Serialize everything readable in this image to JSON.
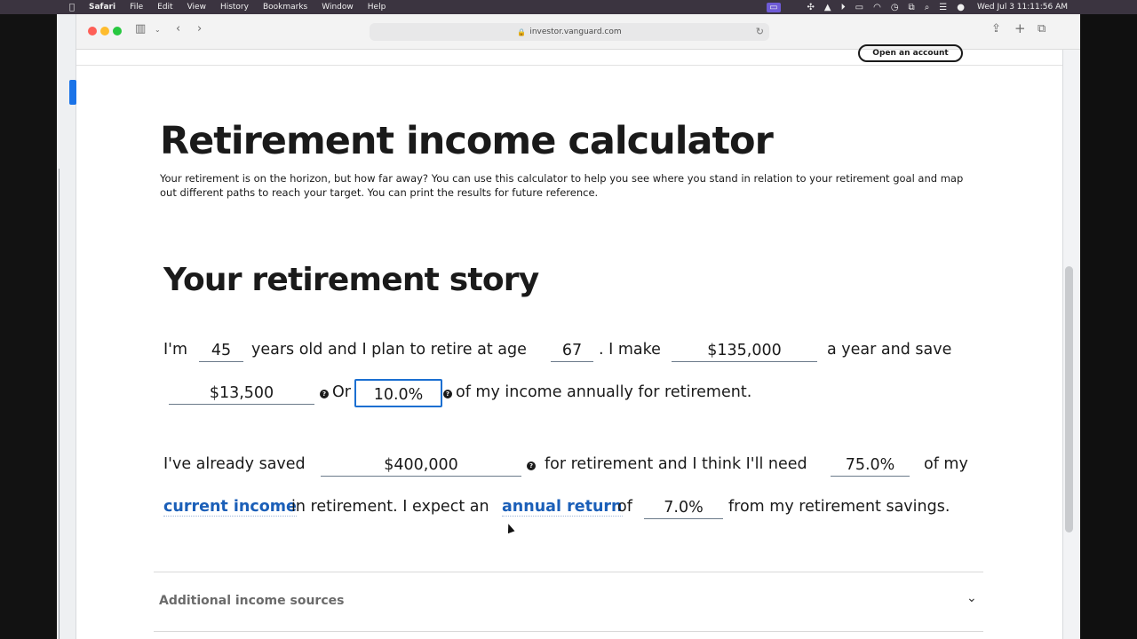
{
  "menubar": {
    "app": "Safari",
    "items": [
      "File",
      "Edit",
      "View",
      "History",
      "Bookmarks",
      "Window",
      "Help"
    ],
    "datetime": "Wed Jul 3  11:11:56 AM"
  },
  "browser": {
    "url": "investor.vanguard.com",
    "header_button": "Open an account"
  },
  "page": {
    "title": "Retirement income calculator",
    "intro": "Your retirement is on the horizon, but how far away? You can use this calculator to help you see where you stand in relation to your retirement goal and map out different paths to reach your target. You can print the results for future reference.",
    "section_title": "Your retirement story"
  },
  "story": {
    "t1": "I'm",
    "age": "45",
    "t2": "years old and I plan to retire at age",
    "retire_age": "67",
    "t3": ". I make",
    "income": "$135,000",
    "t4": "a year and save",
    "savings_amount": "$13,500",
    "t5": "Or",
    "savings_pct": "10.0%",
    "t6": "of my income annually for retirement.",
    "t7": "I've already saved",
    "saved": "$400,000",
    "t8": "for retirement and I think I'll need",
    "need_pct": "75.0%",
    "t9": "of my",
    "link_income": "current income",
    "t10": "in retirement. I expect an",
    "link_return": "annual return",
    "t11": "of",
    "return_pct": "7.0%",
    "t12": "from my retirement savings."
  },
  "accordion": {
    "additional": "Additional income sources"
  }
}
